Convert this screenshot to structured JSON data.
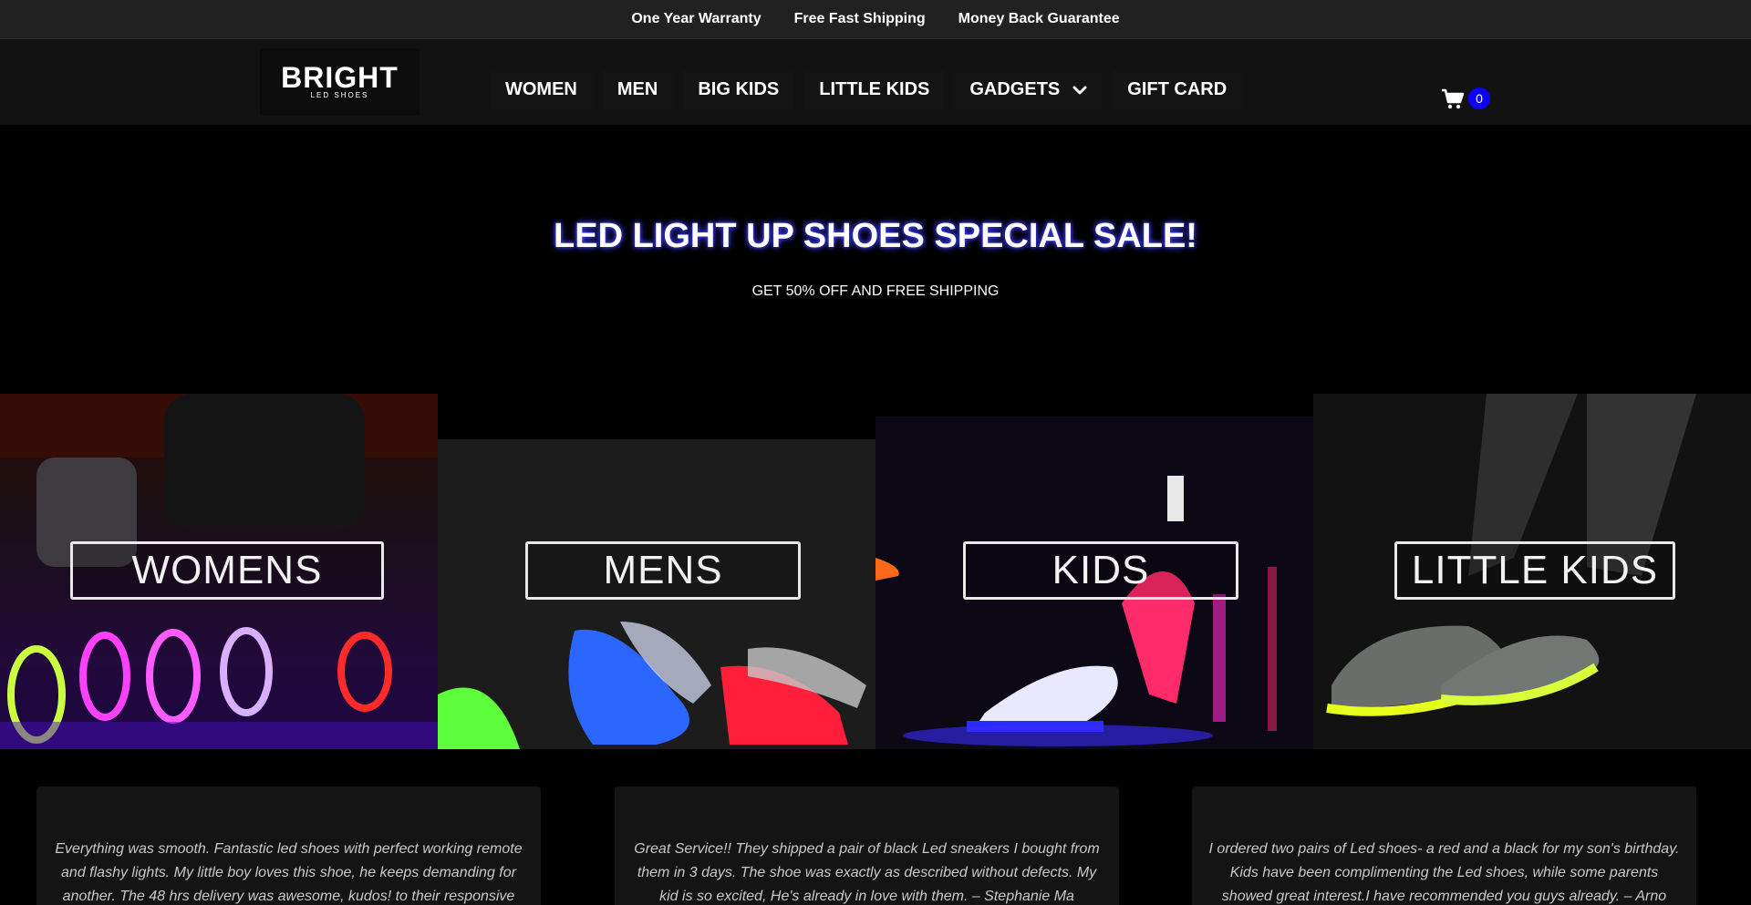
{
  "topbar": {
    "items": [
      "One Year Warranty",
      "Free Fast Shipping",
      "Money Back Guarantee"
    ]
  },
  "header": {
    "logo_word": "BRIGHT",
    "logo_sub": "LED SHOES",
    "nav": [
      {
        "label": "WOMEN"
      },
      {
        "label": "MEN"
      },
      {
        "label": "BIG KIDS"
      },
      {
        "label": "LITTLE KIDS"
      },
      {
        "label": "GADGETS",
        "icon": "chevron-down-icon"
      },
      {
        "label": "GIFT CARD"
      }
    ],
    "cart_icon": "cart-icon",
    "cart_count": "0"
  },
  "hero": {
    "title": "LED LIGHT UP SHOES SPECIAL SALE!",
    "subtitle": "GET 50% OFF AND FREE SHIPPING"
  },
  "categories": [
    {
      "label": "WOMENS"
    },
    {
      "label": "MENS"
    },
    {
      "label": "KIDS"
    },
    {
      "label": "LITTLE KIDS"
    }
  ],
  "reviews": [
    {
      "text": "Everything was smooth. Fantastic led shoes with perfect working remote and flashy lights. My little boy loves this shoe, he keeps demanding for another. The 48 hrs delivery was awesome, kudos! to their responsive"
    },
    {
      "text": "Great Service!! They shipped a pair of black Led sneakers I bought from them in 3 days. The shoe was exactly as described without defects. My kid is so excited, He's already in love with them. – Stephanie Ma"
    },
    {
      "text": "I ordered two pairs of Led shoes- a red and a black for my son's birthday. Kids have been complimenting the Led shoes, while some parents showed great interest.I have recommended you guys already. – Arno"
    }
  ],
  "colors": {
    "topbar_bg": "#212121",
    "header_bg": "#121212",
    "accent_blue": "#0d00ff",
    "page_bg": "#000000"
  }
}
